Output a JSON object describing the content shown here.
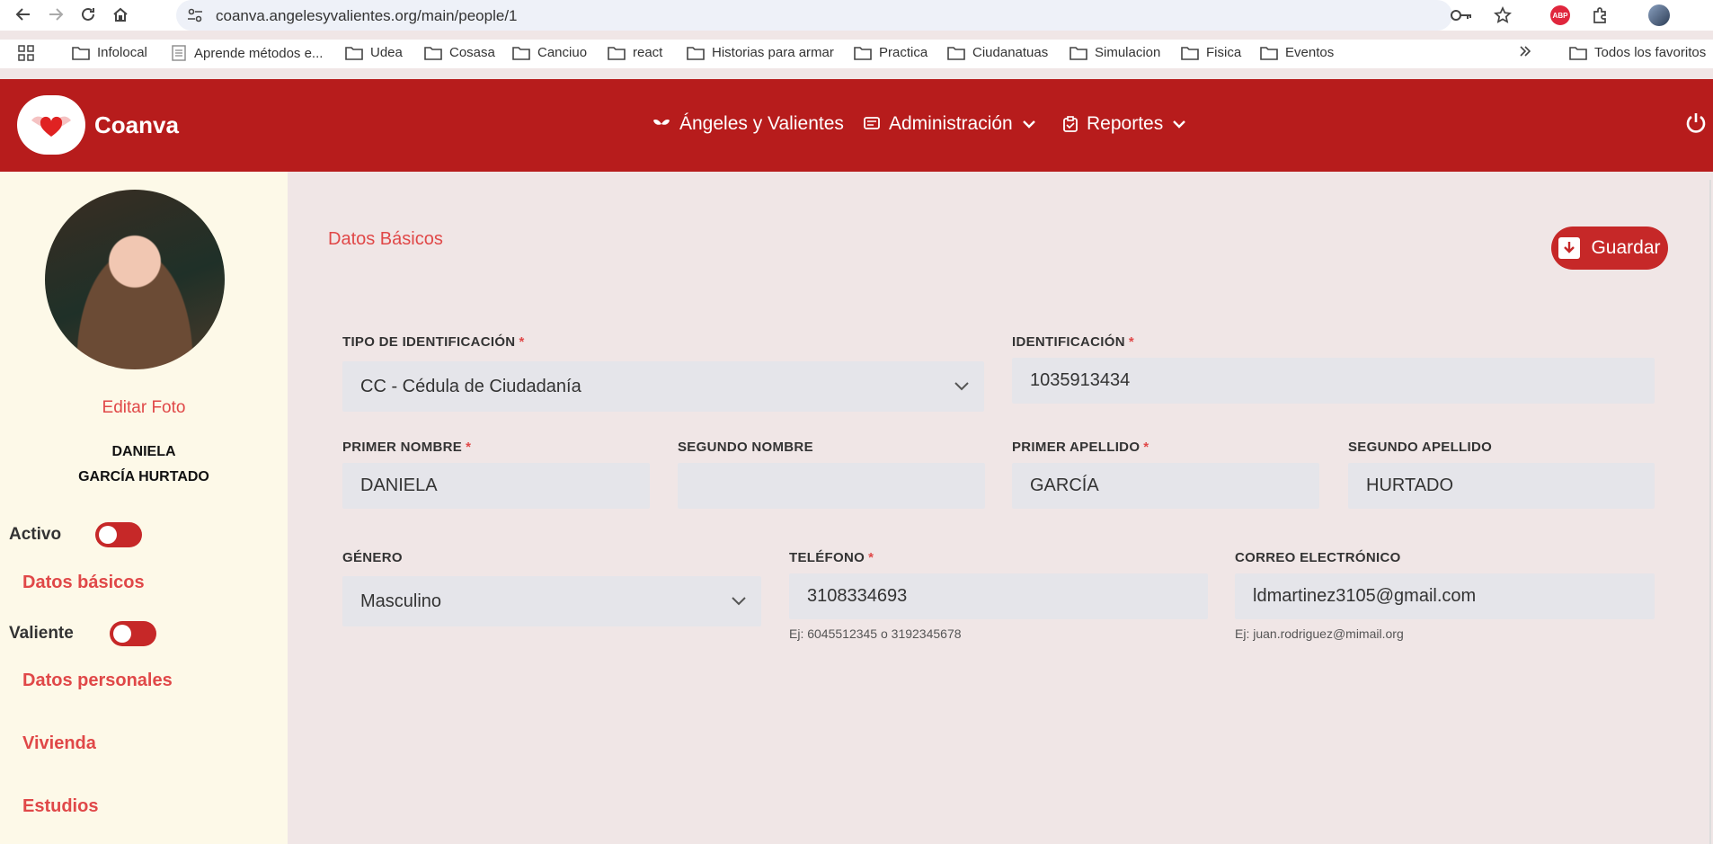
{
  "browser": {
    "url": "coanva.angelesyvalientes.org/main/people/1",
    "bookmarks": [
      "Infolocal",
      "Aprende métodos e...",
      "Udea",
      "Cosasa",
      "Canciuo",
      "react",
      "Historias para armar",
      "Practica",
      "Ciudanatuas",
      "Simulacion",
      "Fisica",
      "Eventos"
    ],
    "all_favorites": "Todos los favoritos",
    "abp_label": "ABP"
  },
  "header": {
    "brand": "Coanva",
    "menu": [
      "Ángeles y Valientes",
      "Administración",
      "Reportes"
    ]
  },
  "sidebar": {
    "edit_photo": "Editar Foto",
    "first_name": "DANIELA",
    "last_names": "GARCÍA HURTADO",
    "toggles": [
      {
        "label": "Activo",
        "on": false
      },
      {
        "label": "Valiente",
        "on": false
      }
    ],
    "links": [
      "Datos básicos",
      "Datos personales",
      "Vivienda",
      "Estudios"
    ]
  },
  "main": {
    "section_title": "Datos Básicos",
    "save_label": "Guardar",
    "fields": {
      "id_type": {
        "label": "TIPO DE IDENTIFICACIÓN",
        "required": "*",
        "value": "CC - Cédula de Ciudadanía"
      },
      "id_number": {
        "label": "IDENTIFICACIÓN",
        "required": "*",
        "value": "1035913434"
      },
      "first_name": {
        "label": "PRIMER NOMBRE",
        "required": "*",
        "value": "DANIELA"
      },
      "second_name": {
        "label": "SEGUNDO NOMBRE",
        "value": ""
      },
      "first_surname": {
        "label": "PRIMER APELLIDO",
        "required": "*",
        "value": "GARCÍA"
      },
      "second_surname": {
        "label": "SEGUNDO APELLIDO",
        "value": "HURTADO"
      },
      "gender": {
        "label": "GÉNERO",
        "value": "Masculino"
      },
      "phone": {
        "label": "TELÉFONO",
        "required": "*",
        "value": "3108334693",
        "hint": "Ej: 6045512345 o 3192345678"
      },
      "email": {
        "label": "CORREO ELECTRÓNICO",
        "value": "ldmartinez3105@gmail.com",
        "hint": "Ej: juan.rodriguez@mimail.org"
      }
    }
  },
  "colors": {
    "brand": "#b71c1c",
    "accent": "#e04848",
    "sidebar_bg": "#fdf9e8",
    "main_bg": "#f0e6e6"
  }
}
